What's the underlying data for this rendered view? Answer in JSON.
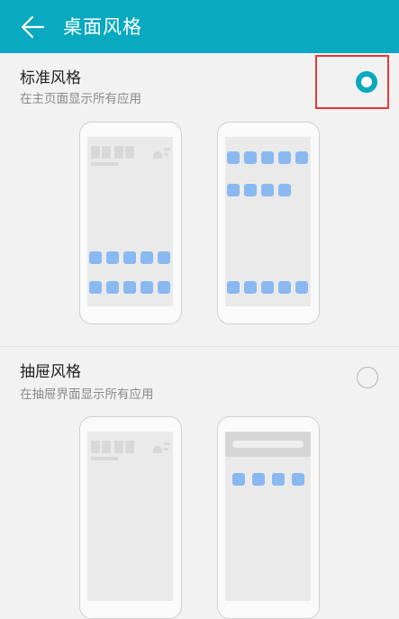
{
  "header": {
    "title": "桌面风格",
    "back_icon": "back-arrow-icon"
  },
  "options": [
    {
      "title": "标准风格",
      "subtitle": "在主页面显示所有应用",
      "selected": true
    },
    {
      "title": "抽屉风格",
      "subtitle": "在抽屉界面显示所有应用",
      "selected": false
    }
  ],
  "colors": {
    "accent": "#09a9bf",
    "highlight_box": "#e53935",
    "app_icon": "#89b9f0"
  }
}
